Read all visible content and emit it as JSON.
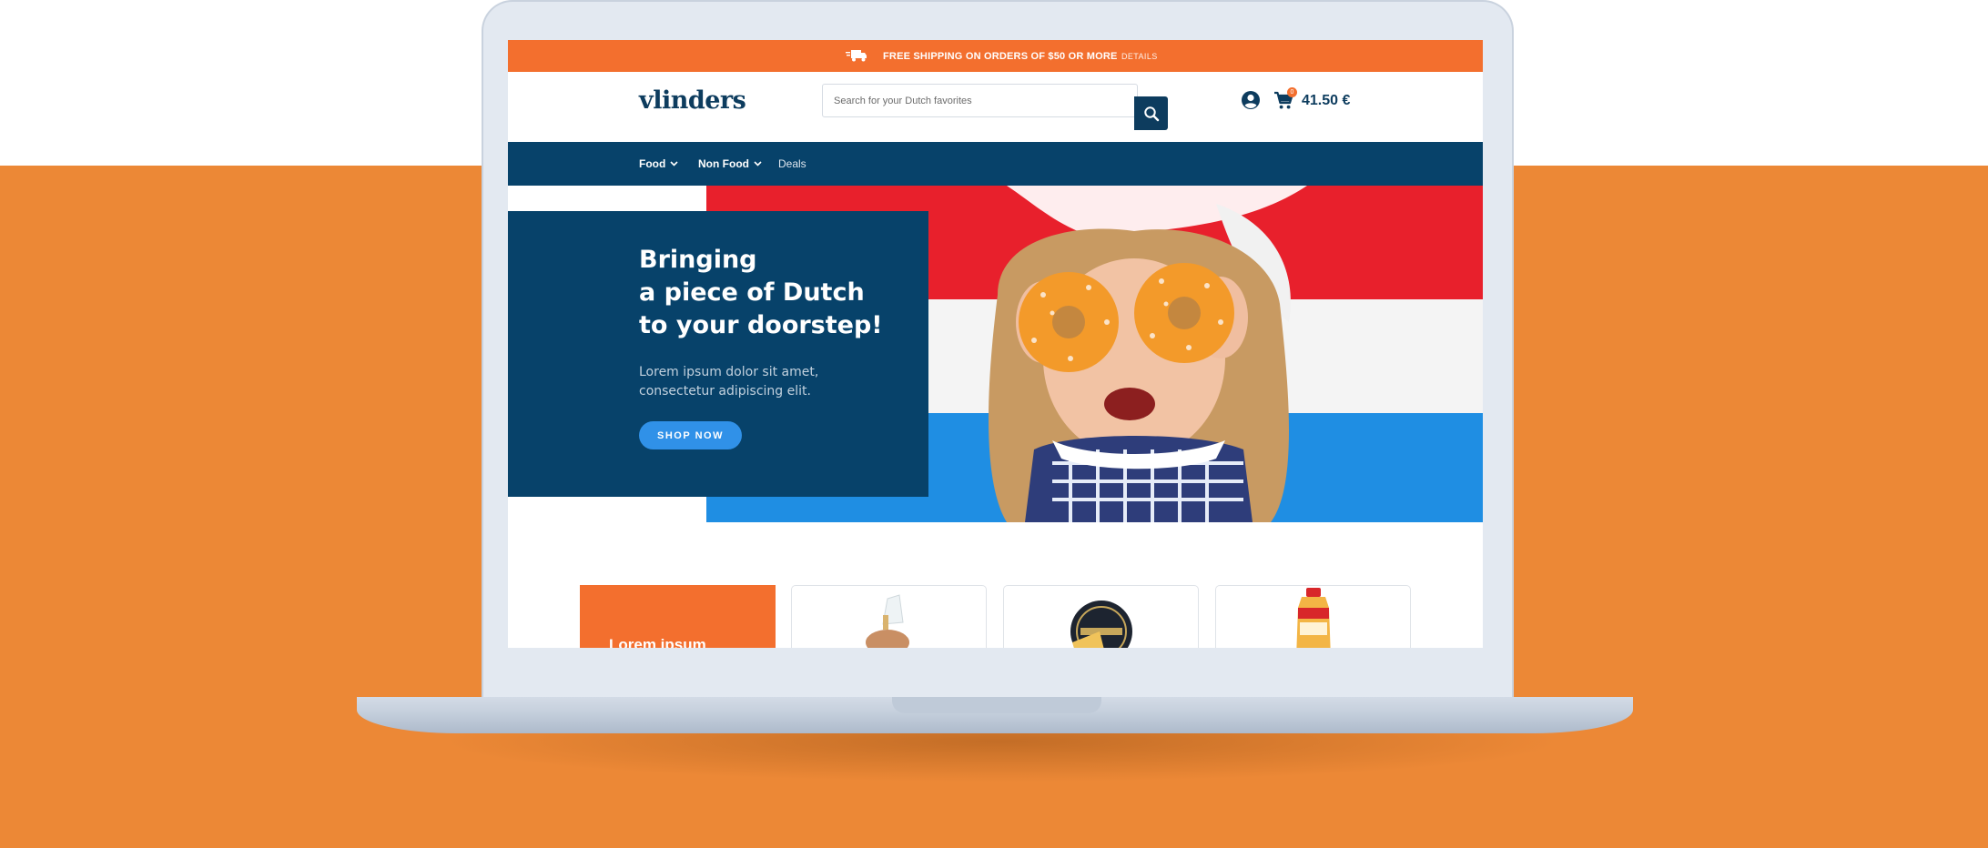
{
  "colors": {
    "accent_orange": "#f36f2e",
    "navy": "#07426a",
    "button_blue": "#3091e8",
    "background_orange": "#ec8836"
  },
  "promo": {
    "icon": "truck-icon",
    "text": "FREE SHIPPING ON ORDERS OF $50 OR MORE",
    "details_link": "DETAILS"
  },
  "header": {
    "logo": "vlinders",
    "search_placeholder": "Search for your Dutch favorites",
    "search_icon": "search-icon",
    "account_icon": "user-icon",
    "cart_icon": "cart-icon",
    "cart_badge": "0",
    "cart_total": "41.50 €"
  },
  "nav": {
    "items": [
      {
        "label": "Food",
        "dropdown": true
      },
      {
        "label": "Non Food",
        "dropdown": true
      },
      {
        "label": "Deals",
        "dropdown": false
      }
    ]
  },
  "hero": {
    "line1": "Bringing",
    "line2": "a piece of Dutch",
    "line3": "to your doorstep!",
    "subtitle": "Lorem ipsum dolor sit amet, consectetur adipiscing elit.",
    "cta": "SHOP NOW"
  },
  "categories": {
    "promo_card_title": "Lorem ipsum"
  }
}
